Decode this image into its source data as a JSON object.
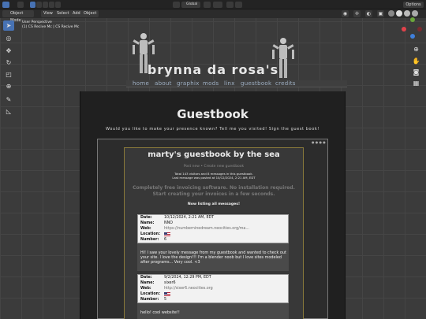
{
  "blender": {
    "mode": "Object Mode",
    "menus": [
      "View",
      "Select",
      "Add",
      "Object"
    ],
    "transform_orientation": "Global",
    "options_label": "Options",
    "viewport_title": "User Perspective",
    "viewport_collection": "(1) CS Recive Mc | CS Recive Mc"
  },
  "site": {
    "title": "brynna da rosa's",
    "nav": [
      "home",
      "about",
      "graphix",
      "mods",
      "linx",
      "guestbook",
      "credits"
    ]
  },
  "page": {
    "heading": "Guestbook",
    "subtitle": "Would you like to make your presence known? Tell me you visited! Sign the guest book!"
  },
  "guestbook": {
    "title": "marty's guestbook by the sea",
    "links": "Post new • Create new guestbook",
    "stats_line1": "Total 143 visitors and 8 messages in this guestbook.",
    "stats_line2": "Last message was posted at 10/12/2024, 2:21 AM, EDT",
    "promo_line1": "Completely free invoicing software. No installation required.",
    "promo_line2": "Start creating your invoices in a few seconds.",
    "listing": "Now listing all messages!",
    "labels": {
      "date": "Date:",
      "name": "Name:",
      "web": "Web:",
      "location": "Location:",
      "number": "Number:"
    },
    "entries": [
      {
        "date": "10/12/2024, 2:21 AM, EDT",
        "name": "NNO",
        "web": "https://numberninedream.neocities.org/ma...",
        "number": "6",
        "message": "Hi! I saw your lovely message from my guestbook and wanted to check out your site. I love the design!!! I'm a blender noob but I love sites modeled after programs... Very cool. <3"
      },
      {
        "date": "9/2/2024, 12:29 PM, EDT",
        "name": "sixer6",
        "web": "http://sixer6.neocities.org",
        "number": "5",
        "message": "hello! cool website!!"
      }
    ]
  },
  "colors": {
    "blender_accent": "#4772b3",
    "axis_x": "#e0424b",
    "axis_y": "#6aa63a",
    "axis_z": "#3f7fdb",
    "guestbook_border": "#8a7a3a"
  }
}
